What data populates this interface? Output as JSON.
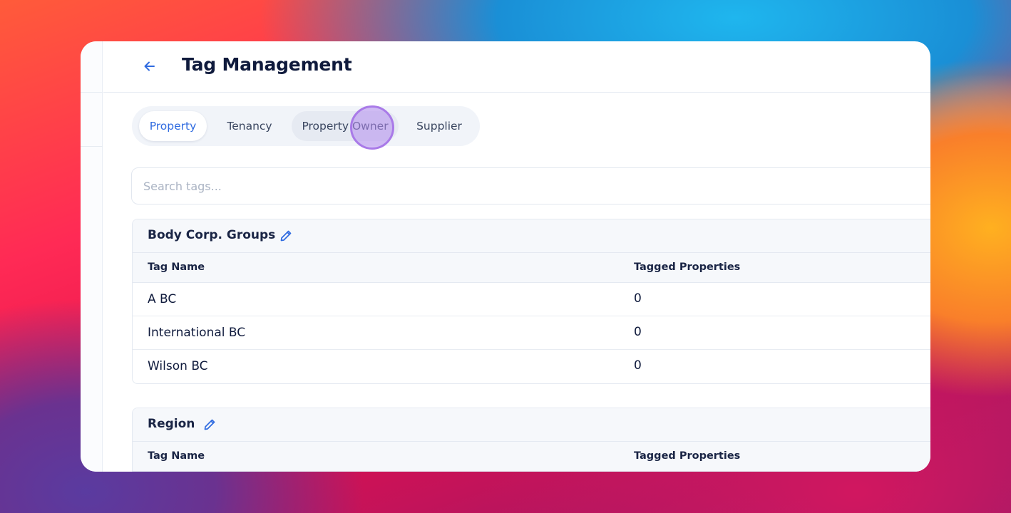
{
  "header": {
    "title": "Tag Management"
  },
  "tabs": [
    {
      "label": "Property",
      "active": true
    },
    {
      "label": "Tenancy",
      "active": false
    },
    {
      "label": "Property Owner",
      "active": false
    },
    {
      "label": "Supplier",
      "active": false
    }
  ],
  "search": {
    "placeholder": "Search tags..."
  },
  "groups": [
    {
      "title": "Body Corp. Groups",
      "columns": [
        "Tag Name",
        "Tagged Properties"
      ],
      "rows": [
        {
          "name": "A BC",
          "count": "0"
        },
        {
          "name": "International BC",
          "count": "0"
        },
        {
          "name": "Wilson BC",
          "count": "0"
        }
      ]
    },
    {
      "title": "Region",
      "columns": [
        "Tag Name",
        "Tagged Properties"
      ],
      "rows": []
    }
  ],
  "colors": {
    "accent": "#2f6be0",
    "title": "#0f1a3c",
    "cursor_ring": "#a97ae8"
  },
  "icons": {
    "back": "arrow-left-icon",
    "edit": "pencil-icon"
  }
}
